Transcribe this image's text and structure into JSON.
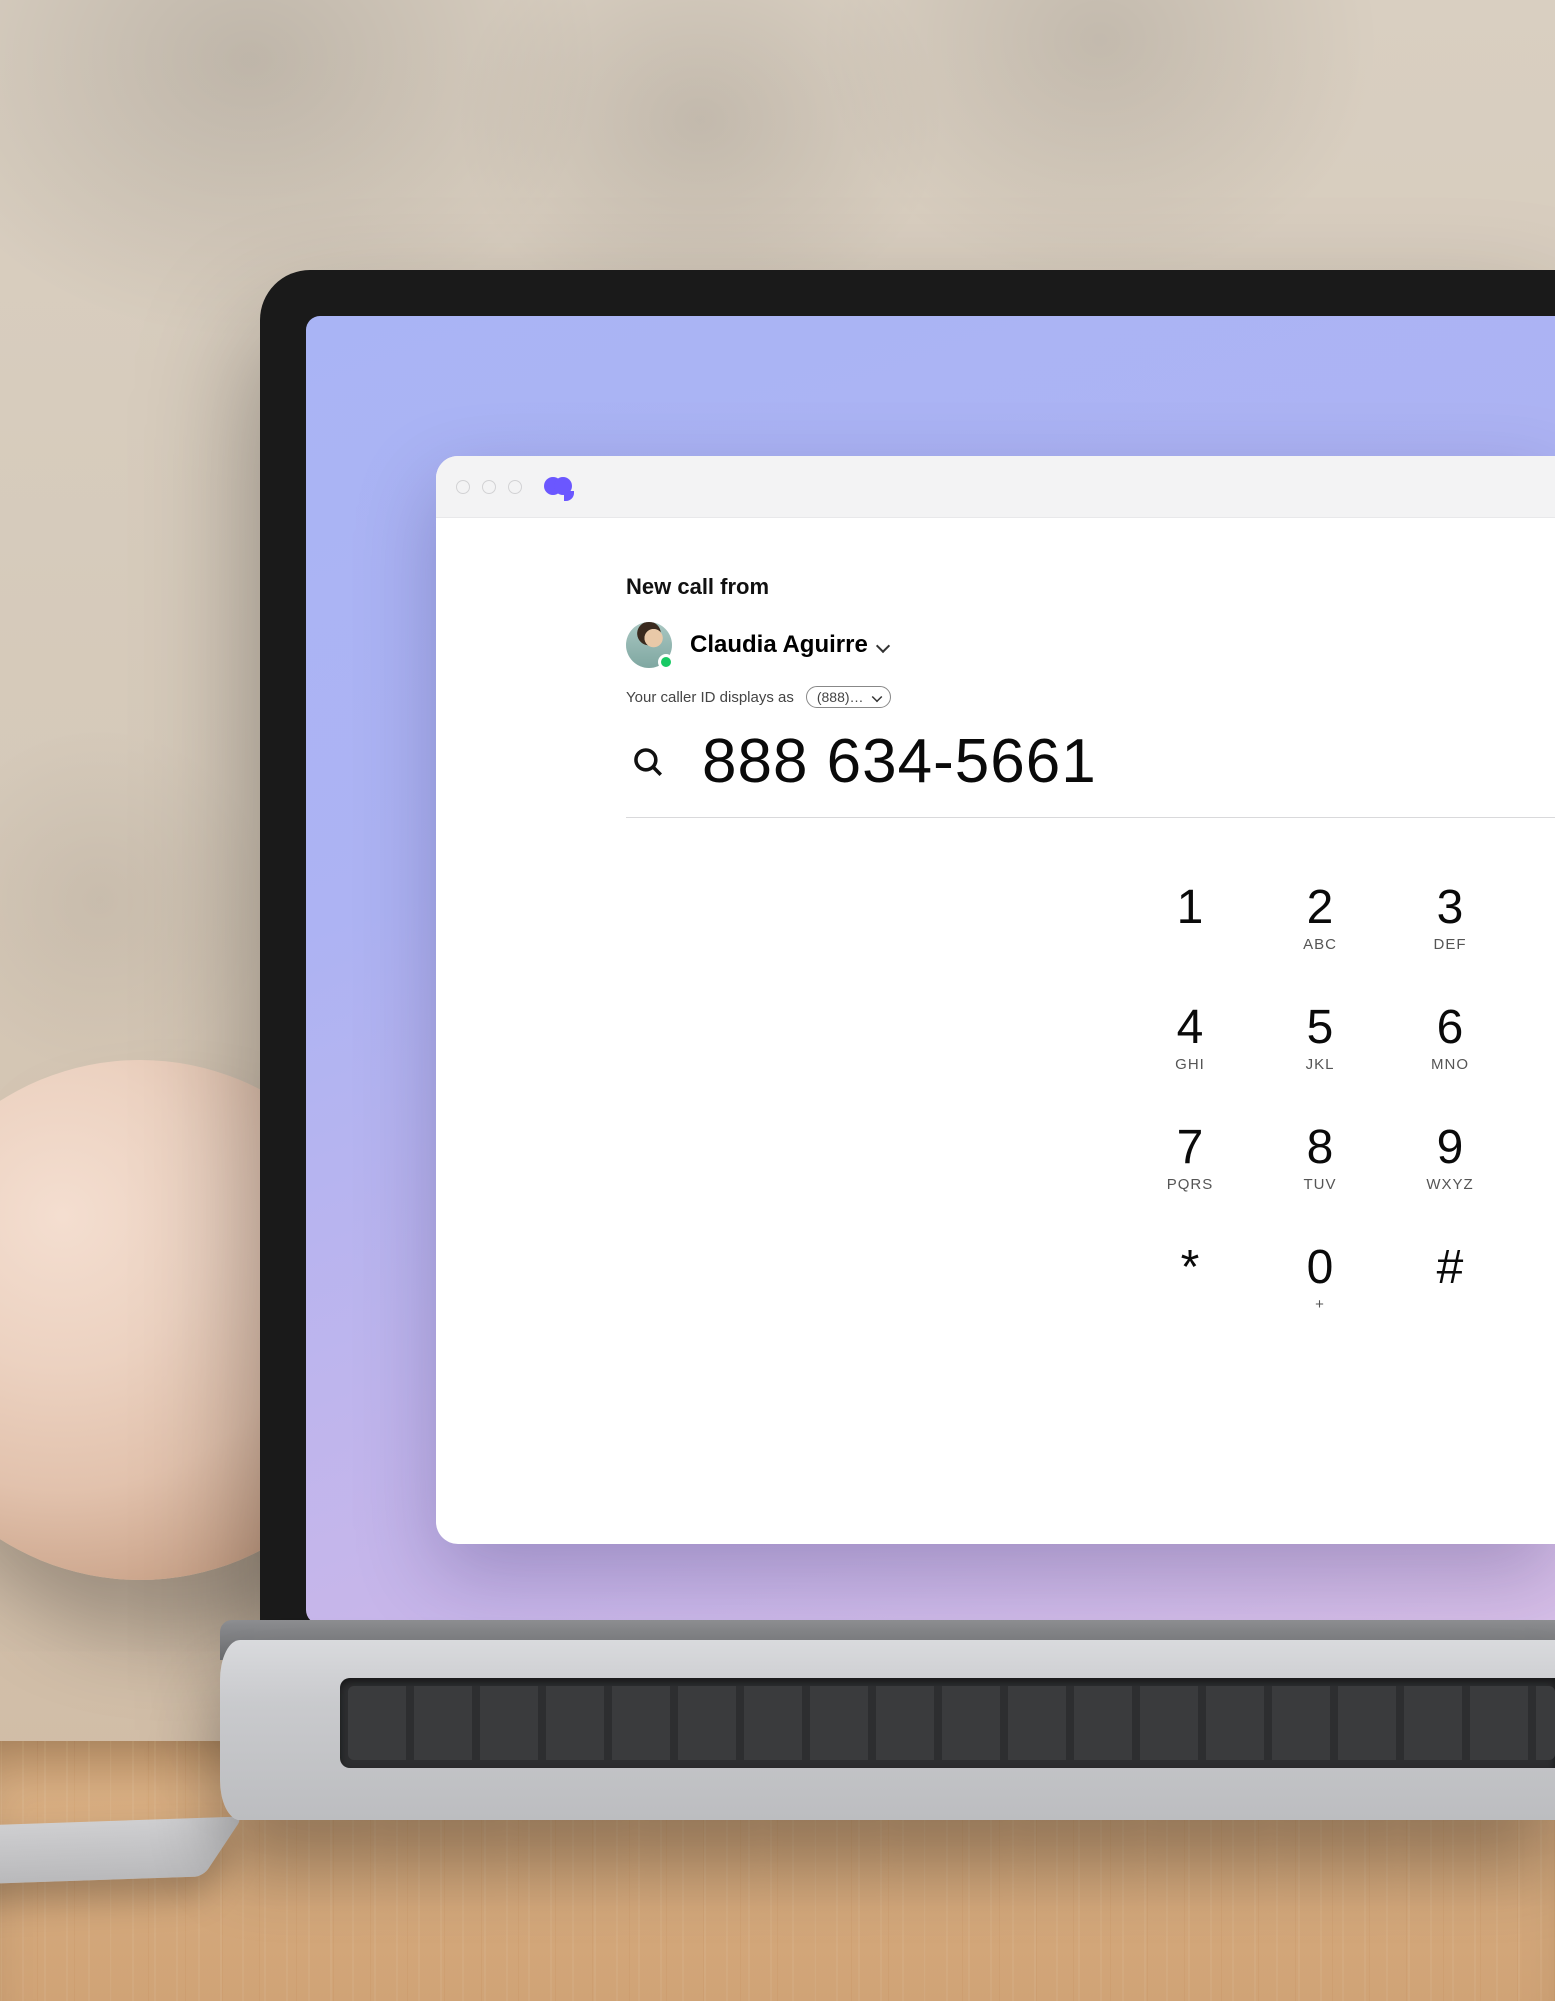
{
  "header": {
    "label": "New call from"
  },
  "identity": {
    "name": "Claudia Aguirre",
    "presence": "online"
  },
  "callerId": {
    "label": "Your caller ID displays as",
    "selected": "(888)…"
  },
  "dial": {
    "number": "888 634-5661"
  },
  "keypad": [
    {
      "digit": "1",
      "letters": ""
    },
    {
      "digit": "2",
      "letters": "ABC"
    },
    {
      "digit": "3",
      "letters": "DEF"
    },
    {
      "digit": "4",
      "letters": "GHI"
    },
    {
      "digit": "5",
      "letters": "JKL"
    },
    {
      "digit": "6",
      "letters": "MNO"
    },
    {
      "digit": "7",
      "letters": "PQRS"
    },
    {
      "digit": "8",
      "letters": "TUV"
    },
    {
      "digit": "9",
      "letters": "WXYZ"
    },
    {
      "digit": "*",
      "letters": ""
    },
    {
      "digit": "0",
      "letters": "+"
    },
    {
      "digit": "#",
      "letters": ""
    }
  ],
  "colors": {
    "brand": "#6b57ff",
    "presence_online": "#18c964"
  }
}
